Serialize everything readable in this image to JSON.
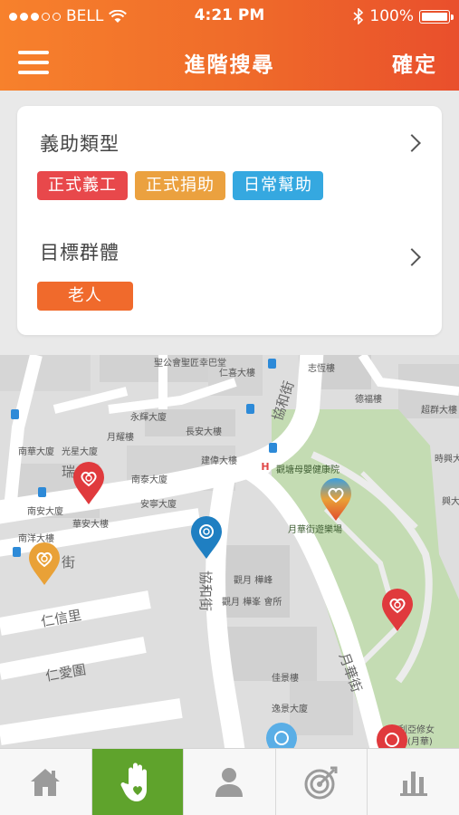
{
  "status_bar": {
    "carrier": "BELL",
    "time": "4:21 PM",
    "battery": "100%"
  },
  "header": {
    "title": "進階搜尋",
    "confirm_label": "確定"
  },
  "filters": {
    "service_type": {
      "label": "義助類型",
      "chips": [
        {
          "label": "正式義工",
          "color": "#e8484b"
        },
        {
          "label": "正式捐助",
          "color": "#eba13f"
        },
        {
          "label": "日常幫助",
          "color": "#35a8e0"
        }
      ]
    },
    "target_group": {
      "label": "目標群體",
      "chips": [
        {
          "label": "老人",
          "color": "#f06a2c"
        }
      ]
    }
  },
  "map": {
    "labels": {
      "l1": "聖公會聖匠幸巴堂",
      "l2": "仁喜大樓",
      "l3": "志恆樓",
      "l4": "協和街",
      "l5": "德福樓",
      "l6": "超群大樓",
      "l7": "永輝大廈",
      "l8": "長安大樓",
      "l9": "月耀樓",
      "l10": "建偉大樓",
      "l11": "南華大廈",
      "l12": "光星大廈",
      "l13": "時興大",
      "l14": "觀塘母嬰健康院",
      "l15": "南泰大廈",
      "l16": "安寧大廈",
      "l17": "南安大廈",
      "l18": "華安大樓",
      "l19": "月華街遊樂場",
      "l20": "南洋大樓",
      "l21": "觀月 樺峰",
      "l22": "觀月 樺峯 會所",
      "l23": "佳景樓",
      "l24": "逸景大廈",
      "l25": "利亞修女",
      "l26": "校(月華)",
      "l27": "興大"
    },
    "streets": {
      "s1": "仁信里",
      "s2": "仁愛圍",
      "s3": "協和街",
      "s4": "月華街",
      "s5": "街",
      "s6": "瑞"
    },
    "hospital_icon": "H"
  },
  "tabbar": {
    "tabs": [
      {
        "icon": "home-icon"
      },
      {
        "icon": "hand-heart-icon",
        "active": true
      },
      {
        "icon": "person-icon"
      },
      {
        "icon": "target-icon"
      },
      {
        "icon": "bar-chart-icon"
      }
    ]
  }
}
